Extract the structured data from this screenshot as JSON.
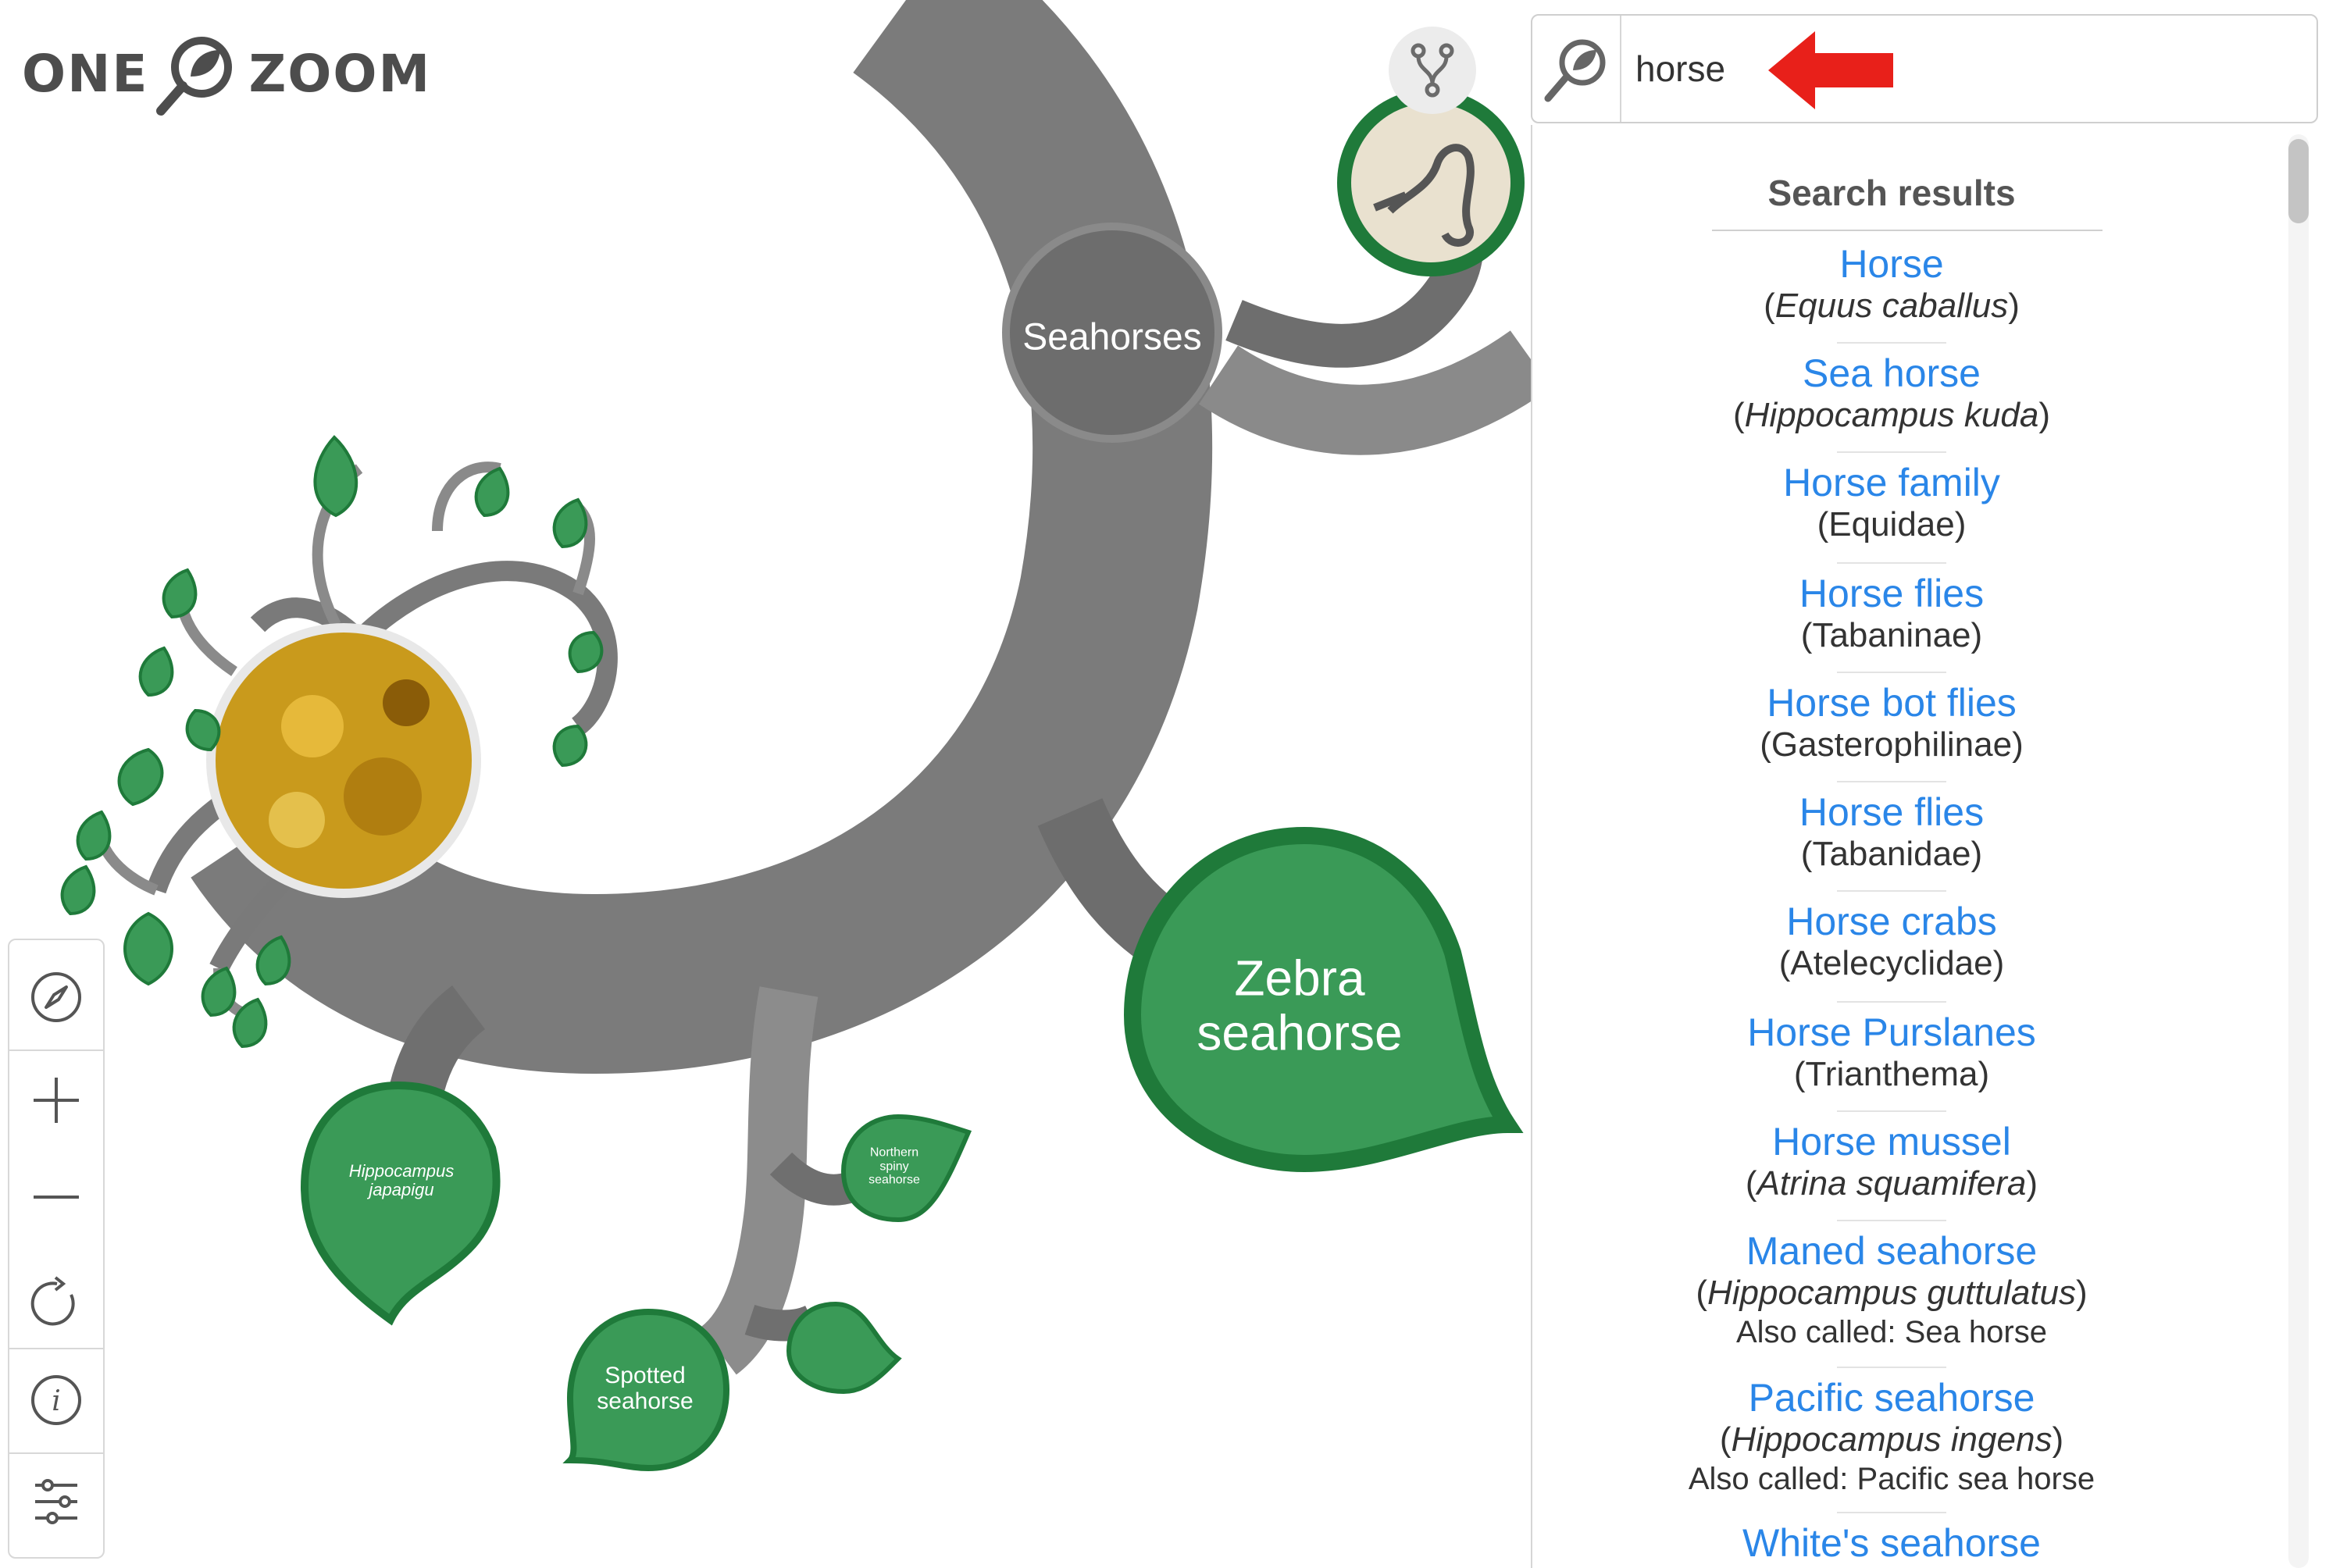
{
  "app": {
    "logo_left": "ONE",
    "logo_right": "ZOOM",
    "colors": {
      "leaf": "#3a9a57",
      "leaf_dark": "#1f7a3a",
      "branch": "#8a8a8a",
      "branch_dark": "#6f6f6f",
      "link": "#2a86e8",
      "arrow": "#e8201a"
    }
  },
  "tree": {
    "clade_label": "Seahorses",
    "leaves": {
      "zebra": "Zebra seahorse",
      "japapigu_1": "Hippocampus",
      "japapigu_2": "japapigu",
      "northern_1": "Northern",
      "northern_2": "spiny",
      "northern_3": "seahorse",
      "spotted_1": "Spotted",
      "spotted_2": "seahorse",
      "zebra_1": "Zebra",
      "zebra_2": "seahorse"
    }
  },
  "toolbar": {
    "items": [
      {
        "icon": "compass-icon"
      },
      {
        "icon": "zoom-in-icon"
      },
      {
        "icon": "zoom-out-icon"
      },
      {
        "icon": "reset-icon"
      },
      {
        "icon": "info-icon"
      },
      {
        "icon": "settings-sliders-icon"
      }
    ]
  },
  "search": {
    "value": "horse",
    "results_title": "Search results",
    "results": [
      {
        "name": "Horse",
        "sci": "Equus caballus",
        "italic": true
      },
      {
        "name": "Sea horse",
        "sci": "Hippocampus kuda",
        "italic": true
      },
      {
        "name": "Horse family",
        "sci": "Equidae",
        "italic": false
      },
      {
        "name": "Horse flies",
        "sci": "Tabaninae",
        "italic": false
      },
      {
        "name": "Horse bot flies",
        "sci": "Gasterophilinae",
        "italic": false
      },
      {
        "name": "Horse flies",
        "sci": "Tabanidae",
        "italic": false
      },
      {
        "name": "Horse crabs",
        "sci": "Atelecyclidae",
        "italic": false
      },
      {
        "name": "Horse Purslanes",
        "sci": "Trianthema",
        "italic": false
      },
      {
        "name": "Horse mussel",
        "sci": "Atrina squamifera",
        "italic": true
      },
      {
        "name": "Maned seahorse",
        "sci": "Hippocampus guttulatus",
        "italic": true,
        "also": "Also called: Sea horse"
      },
      {
        "name": "Pacific seahorse",
        "sci": "Hippocampus ingens",
        "italic": true,
        "also": "Also called: Pacific sea horse"
      },
      {
        "name": "White's seahorse",
        "sci": "",
        "italic": false
      }
    ]
  }
}
